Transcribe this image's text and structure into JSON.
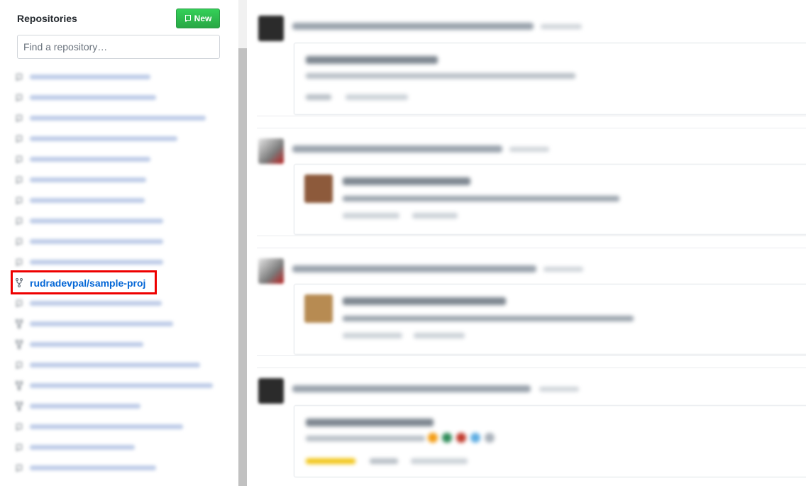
{
  "sidebar": {
    "title": "Repositories",
    "new_button": "New",
    "search_placeholder": "Find a repository…",
    "selected_repo": "rudradevpal/sample-proj",
    "repos": [
      {
        "icon": "repo-icon"
      },
      {
        "icon": "repo-icon"
      },
      {
        "icon": "repo-icon"
      },
      {
        "icon": "repo-icon"
      },
      {
        "icon": "repo-icon"
      },
      {
        "icon": "repo-icon"
      },
      {
        "icon": "repo-icon"
      },
      {
        "icon": "repo-icon"
      },
      {
        "icon": "repo-icon"
      },
      {
        "icon": "repo-icon"
      },
      {
        "icon": "fork-icon",
        "selected": true
      },
      {
        "icon": "repo-icon"
      },
      {
        "icon": "fork-icon"
      },
      {
        "icon": "fork-icon"
      },
      {
        "icon": "repo-icon"
      },
      {
        "icon": "fork-icon"
      },
      {
        "icon": "fork-icon"
      },
      {
        "icon": "repo-icon"
      },
      {
        "icon": "repo-icon"
      },
      {
        "icon": "repo-icon"
      }
    ]
  },
  "colors": {
    "link": "#0366d6",
    "new_button": "#28a745",
    "highlight": "#e00000"
  }
}
